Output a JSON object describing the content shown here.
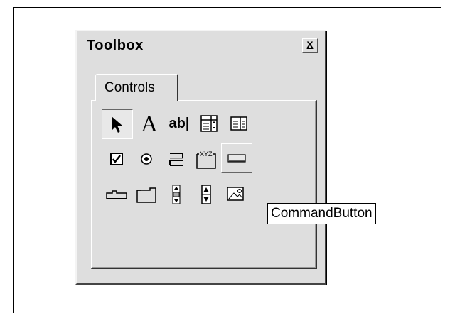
{
  "window": {
    "title": "Toolbox",
    "close_glyph": "x"
  },
  "tabs": [
    {
      "label": "Controls",
      "selected": true
    }
  ],
  "tools": [
    {
      "name": "pointer-tool",
      "icon": "arrow-pointer-icon",
      "state": "pressed"
    },
    {
      "name": "label-tool",
      "icon": "label-a-icon",
      "glyph": "A"
    },
    {
      "name": "textbox-tool",
      "icon": "textbox-icon",
      "glyph": "ab|"
    },
    {
      "name": "combobox-tool",
      "icon": "combobox-icon"
    },
    {
      "name": "listbox-tool",
      "icon": "listbox-icon"
    },
    {
      "name": "checkbox-tool",
      "icon": "checkbox-icon"
    },
    {
      "name": "optionbutton-tool",
      "icon": "radio-button-icon"
    },
    {
      "name": "togglebutton-tool",
      "icon": "toggle-button-icon"
    },
    {
      "name": "frame-tool",
      "icon": "frame-icon",
      "glyph": "XYZ"
    },
    {
      "name": "commandbutton-tool",
      "icon": "command-button-icon",
      "state": "hover"
    },
    {
      "name": "tabstrip-tool",
      "icon": "tabstrip-icon"
    },
    {
      "name": "multipage-tool",
      "icon": "multipage-icon"
    },
    {
      "name": "scrollbar-tool",
      "icon": "scrollbar-icon"
    },
    {
      "name": "spinbutton-tool",
      "icon": "spinbutton-icon"
    },
    {
      "name": "image-tool",
      "icon": "image-icon"
    }
  ],
  "tooltip": {
    "text": "CommandButton"
  }
}
